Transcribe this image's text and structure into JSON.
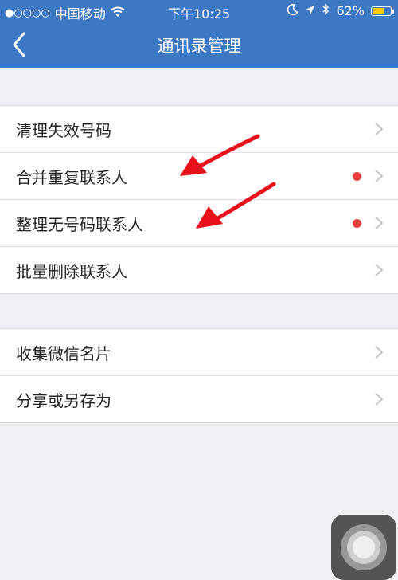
{
  "status_bar": {
    "signal": "●○○○○",
    "carrier": "中国移动",
    "time": "下午10:25",
    "battery": "62%",
    "battery_level": 0.62
  },
  "nav": {
    "title": "通讯录管理",
    "back_icon": "chevron-left-icon"
  },
  "groups": [
    {
      "items": [
        {
          "label": "清理失效号码",
          "badge": false
        },
        {
          "label": "合并重复联系人",
          "badge": true
        },
        {
          "label": "整理无号码联系人",
          "badge": true
        },
        {
          "label": "批量删除联系人",
          "badge": false
        }
      ]
    },
    {
      "items": [
        {
          "label": "收集微信名片",
          "badge": false
        },
        {
          "label": "分享或另存为",
          "badge": false
        }
      ]
    }
  ],
  "colors": {
    "nav_bar": "#3d78c4",
    "background": "#efeff4",
    "badge": "#e84040",
    "annotation_arrow": "#e8101a"
  }
}
